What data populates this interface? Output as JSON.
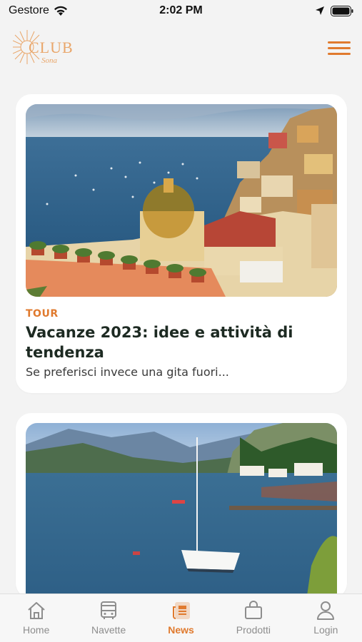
{
  "status_bar": {
    "carrier": "Gestore",
    "time": "2:02 PM"
  },
  "header": {
    "logo_text": "CLUB",
    "logo_subtext": "Sona",
    "menu_icon": "hamburger-menu-icon",
    "brand_color": "#e07a2e"
  },
  "feed": {
    "articles": [
      {
        "category": "TOUR",
        "title": "Vacanze 2023: idee e attività di tendenza",
        "excerpt": "Se preferisci invece una gita fuori..."
      },
      {
        "category": "",
        "title": "",
        "excerpt": ""
      }
    ]
  },
  "tab_bar": {
    "tabs": [
      {
        "label": "Home",
        "icon": "home-icon"
      },
      {
        "label": "Navette",
        "icon": "bus-icon"
      },
      {
        "label": "News",
        "icon": "news-icon",
        "active": true
      },
      {
        "label": "Prodotti",
        "icon": "shopping-bag-icon"
      },
      {
        "label": "Login",
        "icon": "user-icon"
      }
    ]
  }
}
